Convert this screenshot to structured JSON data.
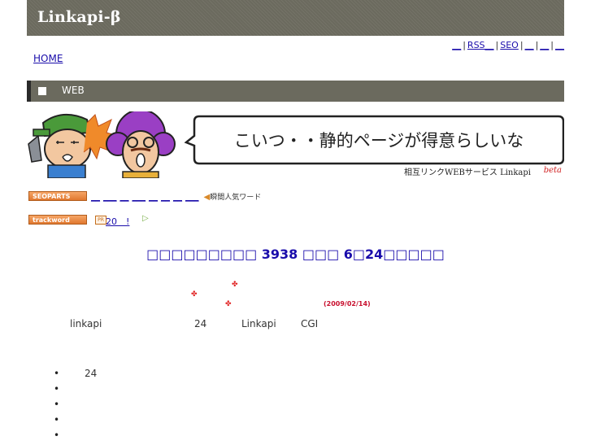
{
  "header": {
    "logo": "Linkapi-β"
  },
  "toplinks": [
    "__",
    "RSS__",
    "SEO",
    "__",
    "__",
    "__"
  ],
  "nav": {
    "home": "HOME"
  },
  "section": {
    "title": "WEB"
  },
  "banner": {
    "speech": "こいつ・・静的ページが得意らしいな",
    "caption": "相互リンクWEBサービス Linkapi",
    "caption_beta": "beta"
  },
  "row1": {
    "badge": "SEOPARTS",
    "links": [
      "__",
      "___",
      "__",
      "___",
      "__",
      "__",
      "__",
      "___"
    ],
    "hot_words": "瞬間人気ワード"
  },
  "row2": {
    "badge": "trackword",
    "pr_icon": "PR",
    "pr_text": "20　!",
    "play_icon": "play-arrow-icon"
  },
  "headline": "□□□□□□□□□ 3938 □□□ 6□24□□□□□",
  "date": "(2009/02/14)",
  "textrow": {
    "a": "linkapi",
    "b": "24",
    "c": "Linkapi",
    "d": "CGI"
  },
  "bullets": [
    "24",
    "",
    "",
    "",
    ""
  ],
  "colors": {
    "bar": "#6b6a5e",
    "link": "#1a0dab",
    "accent": "#c8102e"
  }
}
